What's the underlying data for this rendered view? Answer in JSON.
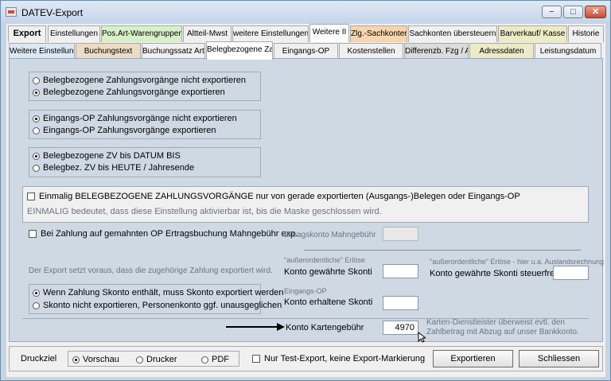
{
  "window": {
    "title": "DATEV-Export",
    "minimize": "−",
    "maximize": "□",
    "close": "✕"
  },
  "tabs_top": [
    {
      "label": "Export"
    },
    {
      "label": "Einstellungen"
    },
    {
      "label": "Pos.Art-Warengruppen"
    },
    {
      "label": "Altteil-Mwst"
    },
    {
      "label": "weitere Einstellungen"
    },
    {
      "label": "Weitere II"
    },
    {
      "label": "Zlg.-Sachkonten"
    },
    {
      "label": "Sachkonten übersteuern"
    },
    {
      "label": "Barverkauf/ Kasse"
    },
    {
      "label": "Historie"
    }
  ],
  "tabs_sub": [
    {
      "label": "Weitere Einstellunge"
    },
    {
      "label": "Buchungstext"
    },
    {
      "label": "Buchungssatz Art/ Ir"
    },
    {
      "label": "Belegbezogene Zah"
    },
    {
      "label": "Eingangs-OP"
    },
    {
      "label": "Kostenstellen"
    },
    {
      "label": "Differenzb. Fzg / Ab"
    },
    {
      "label": "Adressdaten"
    },
    {
      "label": "Leistungsdatum"
    }
  ],
  "group1": {
    "opt_no": "Belegbezogene Zahlungsvorgänge nicht exportieren",
    "opt_yes": "Belegbezogene Zahlungsvorgänge exportieren"
  },
  "group2": {
    "opt_no": "Eingangs-OP Zahlungsvorgänge nicht exportieren",
    "opt_yes": "Eingangs-OP Zahlungsvorgänge exportieren"
  },
  "group3": {
    "opt_a": "Belegbezogene ZV bis DATUM BIS",
    "opt_b": "Belegbez. ZV bis HEUTE / Jahresende"
  },
  "once": {
    "label": "Einmalig BELEGBEZOGENE ZAHLUNGSVORGÄNGE nur von gerade exportierten (Ausgangs-)Belegen oder Eingangs-OP",
    "note": "EINMALIG bedeutet, dass diese Einstellung aktivierbar ist, bis die Maske geschlossen wird."
  },
  "reminder": {
    "label": "Bei Zahlung auf gemahnten OP Ertragsbuchung Mahngebühr exp.",
    "konto_label": "Ertragskonto Mahngebühr",
    "konto_value": ""
  },
  "prereq_note": "Der Export setzt voraus, dass die zugehörige Zahlung exportiert wird.",
  "skonto_given": {
    "caption": "\"außerordentliche\" Erlöse",
    "label": "Konto gewährte Skonti",
    "value": ""
  },
  "skonto_tax": {
    "caption": "\"außerordentliche\" Erlöse - hier u.a. Auslandsrechnung",
    "label": "Konto gewährte Skonti steuerfrei",
    "value": ""
  },
  "skonto_group": {
    "opt_a": "Wenn Zahlung Skonto enthält, muss Skonto exportiert werden",
    "opt_b": "Skonto nicht exportieren, Personenkonto ggf. unausgeglichen"
  },
  "skonto_received": {
    "caption": "Eingangs-OP",
    "label": "Konto erhaltene Skonti",
    "value": ""
  },
  "card_fee": {
    "label": "Konto Kartengebühr",
    "value": "4970",
    "note_line1": "Karten-Dienstleister überweist evtl. den",
    "note_line2": "Zahlbetrag mit Abzug auf unser Bankkonto."
  },
  "bottom": {
    "druckziel": "Druckziel",
    "opt_preview": "Vorschau",
    "opt_printer": "Drucker",
    "opt_pdf": "PDF",
    "test_export": "Nur Test-Export, keine Export-Markierung",
    "export_button": "Exportieren",
    "close_button": "Schliessen"
  }
}
